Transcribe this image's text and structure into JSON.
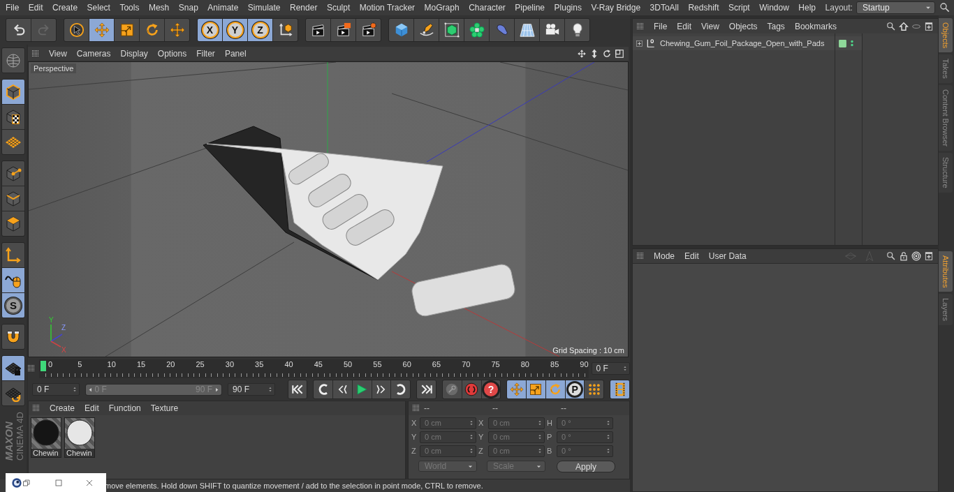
{
  "menubar": {
    "items": [
      "File",
      "Edit",
      "Create",
      "Select",
      "Tools",
      "Mesh",
      "Snap",
      "Animate",
      "Simulate",
      "Render",
      "Sculpt",
      "Motion Tracker",
      "MoGraph",
      "Character",
      "Pipeline",
      "Plugins",
      "V-Ray Bridge",
      "3DToAll",
      "Redshift",
      "Script",
      "Window",
      "Help"
    ],
    "layout_label": "Layout:",
    "layout_value": "Startup"
  },
  "toolbar": [
    {
      "buttons": [
        {
          "kind": "undo",
          "selected": false
        },
        {
          "kind": "redo",
          "selected": false
        }
      ]
    },
    {
      "buttons": [
        {
          "kind": "select",
          "selected": false
        },
        {
          "kind": "move",
          "selected": true
        },
        {
          "kind": "scale",
          "selected": false
        },
        {
          "kind": "rotate",
          "selected": false
        },
        {
          "kind": "transform",
          "selected": false
        }
      ]
    },
    {
      "buttons": [
        {
          "kind": "axislock",
          "label": "X",
          "selected": true
        },
        {
          "kind": "axislock",
          "label": "Y",
          "selected": true
        },
        {
          "kind": "axislock",
          "label": "Z",
          "selected": true
        },
        {
          "kind": "coords",
          "selected": false
        }
      ]
    },
    {
      "buttons": [
        {
          "kind": "render",
          "selected": false
        },
        {
          "kind": "renderview",
          "selected": false
        },
        {
          "kind": "rendersettings",
          "selected": false
        }
      ]
    },
    {
      "buttons": [
        {
          "kind": "cube",
          "selected": false
        },
        {
          "kind": "pen",
          "selected": false
        },
        {
          "kind": "subdiv",
          "selected": false
        },
        {
          "kind": "cloner",
          "selected": false
        },
        {
          "kind": "deformer",
          "selected": false
        },
        {
          "kind": "floor",
          "selected": false
        },
        {
          "kind": "camera",
          "selected": false
        },
        {
          "kind": "light",
          "selected": false
        }
      ]
    }
  ],
  "left_tools": [
    {
      "buttons": [
        {
          "kind": "viewcube",
          "selected": false
        }
      ]
    },
    {
      "buttons": [
        {
          "kind": "model",
          "selected": true
        },
        {
          "kind": "texture",
          "selected": false
        },
        {
          "kind": "workplane",
          "selected": false
        }
      ]
    },
    {
      "buttons": [
        {
          "kind": "points",
          "selected": false
        },
        {
          "kind": "edges",
          "selected": false
        },
        {
          "kind": "polygons",
          "selected": false
        }
      ]
    },
    {
      "buttons": [
        {
          "kind": "axis",
          "selected": false
        },
        {
          "kind": "tweak",
          "selected": true
        },
        {
          "kind": "snap",
          "label": "S",
          "selected": true
        }
      ]
    },
    {
      "buttons": [
        {
          "kind": "magnet",
          "selected": false
        }
      ]
    },
    {
      "buttons": [
        {
          "kind": "gridlock",
          "selected": true
        },
        {
          "kind": "gridsync",
          "selected": false
        }
      ]
    }
  ],
  "logo": {
    "brand": "MAXON",
    "product": "CINEMA 4D"
  },
  "viewport": {
    "menu": [
      "View",
      "Cameras",
      "Display",
      "Options",
      "Filter",
      "Panel"
    ],
    "camera_label": "Perspective",
    "grid_spacing": "Grid Spacing : 10 cm",
    "axis_labels": {
      "y": "Y",
      "z": "Z",
      "x": "X"
    }
  },
  "timeline": {
    "ticks": [
      "0",
      "5",
      "10",
      "15",
      "20",
      "25",
      "30",
      "35",
      "40",
      "45",
      "50",
      "55",
      "60",
      "65",
      "70",
      "75",
      "80",
      "85",
      "90"
    ],
    "playhead": {
      "level": 0
    },
    "current_frame": "0 F",
    "start_field": "0 F",
    "range": {
      "start": "0 F",
      "end": "90 F",
      "level": 1
    },
    "end_field": "90 F",
    "transport": [
      {
        "buttons": [
          {
            "kind": "first",
            "selected": false
          }
        ]
      },
      {
        "buttons": [
          {
            "kind": "prevkey",
            "selected": false
          },
          {
            "kind": "prev",
            "selected": false
          },
          {
            "kind": "play",
            "selected": false
          },
          {
            "kind": "next",
            "selected": false
          },
          {
            "kind": "nextkey",
            "selected": false
          }
        ]
      },
      {
        "buttons": [
          {
            "kind": "last",
            "selected": false
          }
        ]
      },
      {
        "buttons": [
          {
            "kind": "autokey",
            "selected": false
          },
          {
            "kind": "record",
            "selected": false
          },
          {
            "kind": "help",
            "label": "?",
            "selected": false
          }
        ]
      },
      {
        "buttons": [
          {
            "kind": "keymove",
            "selected": true
          },
          {
            "kind": "keyscale",
            "selected": true
          },
          {
            "kind": "keyrotate",
            "selected": true
          },
          {
            "kind": "param",
            "label": "P",
            "selected": true
          },
          {
            "kind": "dots",
            "selected": false
          }
        ]
      },
      {
        "buttons": [
          {
            "kind": "film",
            "selected": true
          }
        ]
      }
    ]
  },
  "materials": {
    "menu": [
      "Create",
      "Edit",
      "Function",
      "Texture"
    ],
    "items": [
      {
        "name": "Chewin",
        "color": "#151515"
      },
      {
        "name": "Chewin",
        "color": "#e6e6e6"
      }
    ]
  },
  "coordinates": {
    "headers": [
      "--",
      "--",
      "--"
    ],
    "rows": [
      [
        {
          "axis": "X",
          "value": "0 cm"
        },
        {
          "axis": "X",
          "value": "0 cm"
        },
        {
          "axis": "H",
          "value": "0 °"
        }
      ],
      [
        {
          "axis": "Y",
          "value": "0 cm"
        },
        {
          "axis": "Y",
          "value": "0 cm"
        },
        {
          "axis": "P",
          "value": "0 °"
        }
      ],
      [
        {
          "axis": "Z",
          "value": "0 cm"
        },
        {
          "axis": "Z",
          "value": "0 cm"
        },
        {
          "axis": "B",
          "value": "0 °"
        }
      ]
    ],
    "mode": "World",
    "scale": "Scale",
    "apply": "Apply"
  },
  "status_bar": {
    "text": "move elements. Hold down SHIFT to quantize movement / add to the selection in point mode, CTRL to remove."
  },
  "objects_panel": {
    "menu": [
      "File",
      "Edit",
      "View",
      "Objects",
      "Tags",
      "Bookmarks"
    ],
    "objects": [
      {
        "name": "Chewing_Gum_Foil_Package_Open_with_Pads",
        "expanded": false
      }
    ]
  },
  "attributes_panel": {
    "menu": [
      "Mode",
      "Edit",
      "User Data"
    ]
  },
  "side_tabs": {
    "top": [
      {
        "label": "Objects",
        "selected": true
      },
      {
        "label": "Takes",
        "selected": false
      },
      {
        "label": "Content Browser",
        "selected": false
      },
      {
        "label": "Structure",
        "selected": false
      }
    ],
    "bottom": [
      {
        "label": "Attributes",
        "selected": true
      },
      {
        "label": "Layers",
        "selected": false
      }
    ]
  }
}
